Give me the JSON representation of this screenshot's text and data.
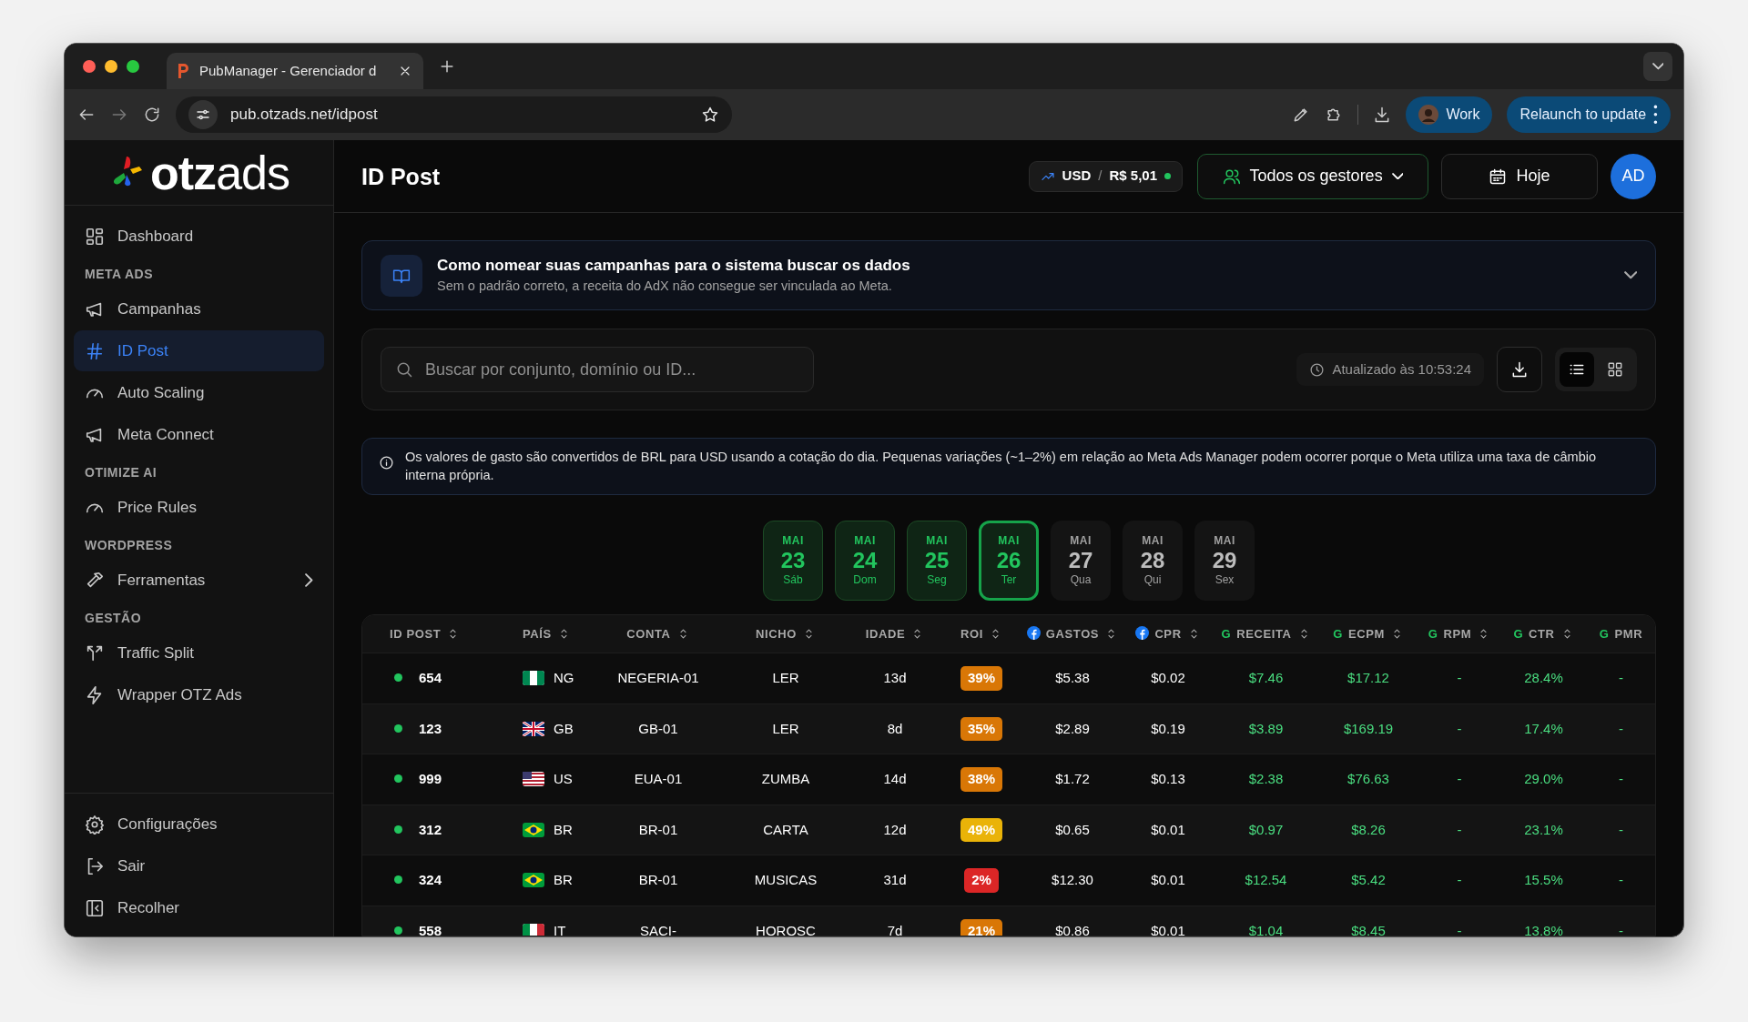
{
  "browser": {
    "tab_title": "PubManager - Gerenciador d",
    "url": "pub.otzads.net/idpost",
    "profile": "Work",
    "update_button": "Relaunch to update"
  },
  "sidebar": {
    "logo": "**otz**ads",
    "items": [
      {
        "kind": "item",
        "label": "Dashboard",
        "selected": false
      },
      {
        "kind": "section",
        "label": "META ADS"
      },
      {
        "kind": "item",
        "label": "Campanhas",
        "selected": false
      },
      {
        "kind": "item",
        "label": "ID Post",
        "selected": true
      },
      {
        "kind": "item",
        "label": "Auto Scaling",
        "selected": false
      },
      {
        "kind": "item",
        "label": "Meta Connect",
        "selected": false
      },
      {
        "kind": "section",
        "label": "OTIMIZE AI"
      },
      {
        "kind": "item",
        "label": "Price Rules",
        "selected": false
      },
      {
        "kind": "section",
        "label": "WORDPRESS"
      },
      {
        "kind": "item",
        "label": "Ferramentas",
        "selected": false,
        "expandable": true
      },
      {
        "kind": "section",
        "label": "GESTÃO"
      },
      {
        "kind": "item",
        "label": "Traffic Split",
        "selected": false
      },
      {
        "kind": "item",
        "label": "Wrapper OTZ Ads",
        "selected": false
      }
    ],
    "footer": [
      {
        "label": "Configurações"
      },
      {
        "label": "Sair"
      },
      {
        "label": "Recolher"
      }
    ]
  },
  "header": {
    "title": "ID Post",
    "currency": "USD",
    "separator": "/",
    "rate": "R$ 5,01",
    "managers": "Todos os gestores",
    "date_button": "Hoje",
    "avatar": "AD"
  },
  "guide": {
    "title": "Como nomear suas campanhas para o sistema buscar os dados",
    "subtitle": "Sem o padrão correto, a receita do AdX não consegue ser vinculada ao Meta."
  },
  "search": {
    "placeholder": "Buscar por conjunto, domínio ou ID...",
    "updated": "Atualizado às 10:53:24",
    "views": [
      {
        "kind": "list",
        "selected": true
      },
      {
        "kind": "grid",
        "selected": false
      }
    ]
  },
  "notice": "Os valores de gasto são convertidos de BRL para USD usando a cotação do dia. Pequenas variações (~1–2%) em relação ao Meta Ads Manager podem ocorrer porque o Meta utiliza uma taxa de câmbio interna própria.",
  "dates": [
    {
      "month": "MAI",
      "day": "23",
      "weekday": "Sáb",
      "has_data": true,
      "selected": false
    },
    {
      "month": "MAI",
      "day": "24",
      "weekday": "Dom",
      "has_data": true,
      "selected": false
    },
    {
      "month": "MAI",
      "day": "25",
      "weekday": "Seg",
      "has_data": true,
      "selected": false
    },
    {
      "month": "MAI",
      "day": "26",
      "weekday": "Ter",
      "has_data": true,
      "selected": true
    },
    {
      "month": "MAI",
      "day": "27",
      "weekday": "Qua",
      "has_data": false,
      "selected": false
    },
    {
      "month": "MAI",
      "day": "28",
      "weekday": "Qui",
      "has_data": false,
      "selected": false
    },
    {
      "month": "MAI",
      "day": "29",
      "weekday": "Sex",
      "has_data": false,
      "selected": false
    }
  ],
  "table": {
    "columns": [
      {
        "label": "ID POST"
      },
      {
        "label": "PAÍS"
      },
      {
        "label": "CONTA"
      },
      {
        "label": "NICHO"
      },
      {
        "label": "IDADE"
      },
      {
        "label": "ROI"
      },
      {
        "label": "GASTOS",
        "kind": "facebook"
      },
      {
        "label": "CPR",
        "kind": "facebook"
      },
      {
        "label": "RECEITA",
        "kind": "google",
        "badge": "G"
      },
      {
        "label": "ECPM",
        "kind": "google",
        "badge": "G"
      },
      {
        "label": "RPM",
        "kind": "google",
        "badge": "G"
      },
      {
        "label": "CTR",
        "kind": "google",
        "badge": "G"
      },
      {
        "label": "PMR",
        "kind": "google",
        "badge": "G"
      }
    ],
    "rows": [
      {
        "active": true,
        "id": "654",
        "country": "NG",
        "account": "NEGERIA-01",
        "niche": "LER",
        "age": "13d",
        "roi": {
          "text": "39%",
          "color": "#d97706"
        },
        "spend": "$5.38",
        "cpr": "$0.02",
        "revenue": "$7.46",
        "ecpm": "$17.12",
        "rpm": "-",
        "ctr": "28.4%",
        "pmr": "-"
      },
      {
        "active": true,
        "id": "123",
        "country": "GB",
        "account": "GB-01",
        "niche": "LER",
        "age": "8d",
        "roi": {
          "text": "35%",
          "color": "#d97706"
        },
        "spend": "$2.89",
        "cpr": "$0.19",
        "revenue": "$3.89",
        "ecpm": "$169.19",
        "rpm": "-",
        "ctr": "17.4%",
        "pmr": "-"
      },
      {
        "active": true,
        "id": "999",
        "country": "US",
        "account": "EUA-01",
        "niche": "ZUMBA",
        "age": "14d",
        "roi": {
          "text": "38%",
          "color": "#d97706"
        },
        "spend": "$1.72",
        "cpr": "$0.13",
        "revenue": "$2.38",
        "ecpm": "$76.63",
        "rpm": "-",
        "ctr": "29.0%",
        "pmr": "-"
      },
      {
        "active": true,
        "id": "312",
        "country": "BR",
        "account": "BR-01",
        "niche": "CARTA",
        "age": "12d",
        "roi": {
          "text": "49%",
          "color": "#eab308"
        },
        "spend": "$0.65",
        "cpr": "$0.01",
        "revenue": "$0.97",
        "ecpm": "$8.26",
        "rpm": "-",
        "ctr": "23.1%",
        "pmr": "-"
      },
      {
        "active": true,
        "id": "324",
        "country": "BR",
        "account": "BR-01",
        "niche": "MUSICAS",
        "age": "31d",
        "roi": {
          "text": "2%",
          "color": "#dc2626"
        },
        "spend": "$12.30",
        "cpr": "$0.01",
        "revenue": "$12.54",
        "ecpm": "$5.42",
        "rpm": "-",
        "ctr": "15.5%",
        "pmr": "-"
      },
      {
        "active": true,
        "id": "558",
        "country": "IT",
        "account": "SACI-",
        "niche": "HOROSC",
        "age": "7d",
        "roi": {
          "text": "21%",
          "color": "#d97706"
        },
        "spend": "$0.86",
        "cpr": "$0.01",
        "revenue": "$1.04",
        "ecpm": "$8.45",
        "rpm": "-",
        "ctr": "13.8%",
        "pmr": "-"
      }
    ]
  }
}
